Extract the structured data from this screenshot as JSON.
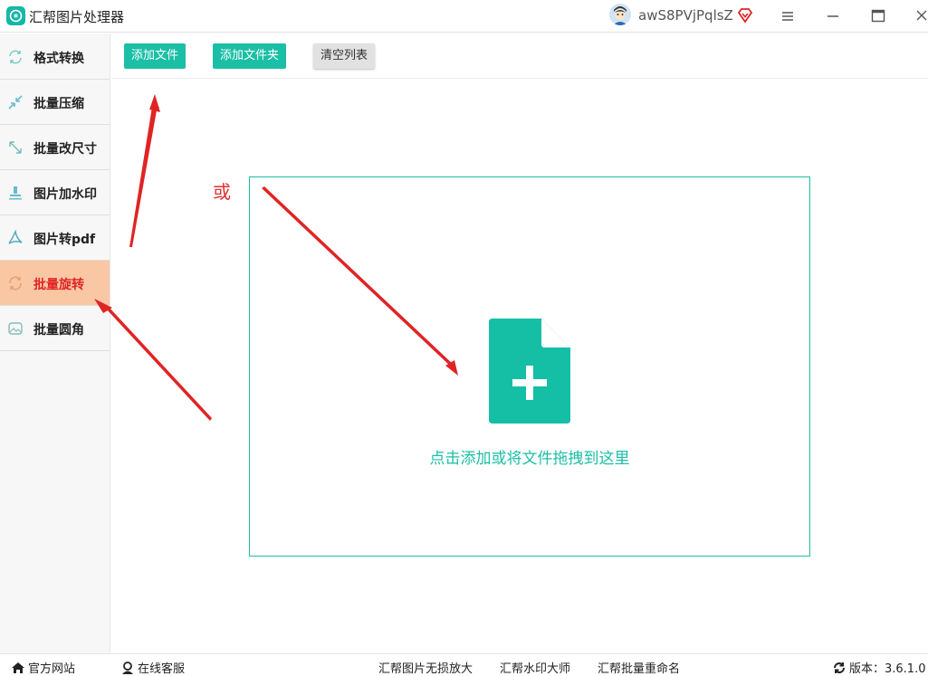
{
  "app": {
    "title": "汇帮图片处理器",
    "username": "awS8PVjPqlsZ",
    "accent_color": "#1bbfa6",
    "active_color": "#f9c7a4",
    "highlight_text_color": "#e02424"
  },
  "window_controls": {
    "menu_icon": "hamburger-icon",
    "minimize_icon": "minimize-icon",
    "maximize_icon": "maximize-icon",
    "close_icon": "close-icon"
  },
  "sidebar": {
    "items": [
      {
        "label": "格式转换",
        "icon": "format-convert-icon",
        "active": false
      },
      {
        "label": "批量压缩",
        "icon": "compress-icon",
        "active": false
      },
      {
        "label": "批量改尺寸",
        "icon": "resize-icon",
        "active": false
      },
      {
        "label": "图片加水印",
        "icon": "watermark-icon",
        "active": false
      },
      {
        "label": "图片转pdf",
        "icon": "pdf-icon",
        "active": false
      },
      {
        "label": "批量旋转",
        "icon": "rotate-icon",
        "active": true
      },
      {
        "label": "批量圆角",
        "icon": "round-corner-icon",
        "active": false
      }
    ]
  },
  "toolbar": {
    "add_file": "添加文件",
    "add_folder": "添加文件夹",
    "clear_list": "清空列表"
  },
  "dropzone": {
    "text": "点击添加或将文件拖拽到这里",
    "icon": "file-add-icon"
  },
  "annotation": {
    "or_text": "或",
    "arrow_color": "#e02424"
  },
  "statusbar": {
    "official_site": "官方网站",
    "online_service": "在线客服",
    "link1": "汇帮图片无损放大",
    "link2": "汇帮水印大师",
    "link3": "汇帮批量重命名",
    "version": "版本：3.6.1.0"
  }
}
